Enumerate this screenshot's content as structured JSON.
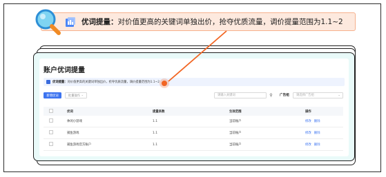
{
  "callout": {
    "title": "优词提量：",
    "description": "对价值更高的关键词单独出价，抢夺优质流量，调价提量范围为1.1~2"
  },
  "page": {
    "title": "账户优词提量",
    "notice_title": "优词提量：",
    "notice_text": "对价值更高的关键词单独出价，抢夺优质流量，调价提量范围为1.1~2"
  },
  "toolbar": {
    "add_button": "新增优词",
    "batch_button": "批量操作",
    "search_placeholder": "请输入关键词",
    "group_label": "广告组",
    "group_placeholder": "请选择广告组"
  },
  "table": {
    "headers": [
      "优词",
      "提量系数",
      "生效范围",
      "操作"
    ],
    "rows": [
      {
        "word": "休闲小游戏",
        "coef": "1.1",
        "scope": "当前账户",
        "actions": [
          "修改",
          "删除"
        ]
      },
      {
        "word": "捕鱼游戏",
        "coef": "1.1",
        "scope": "当前账户",
        "actions": [
          "修改",
          "删除"
        ]
      },
      {
        "word": "捕鱼游戏官方账户",
        "coef": "1.1",
        "scope": "当前账户",
        "actions": [
          "修改",
          "删除"
        ]
      }
    ]
  },
  "colors": {
    "accent": "#3d74f0",
    "highlight": "#f26522",
    "callout_bg": "#fde9de",
    "card_bg": "#e9faf9"
  }
}
